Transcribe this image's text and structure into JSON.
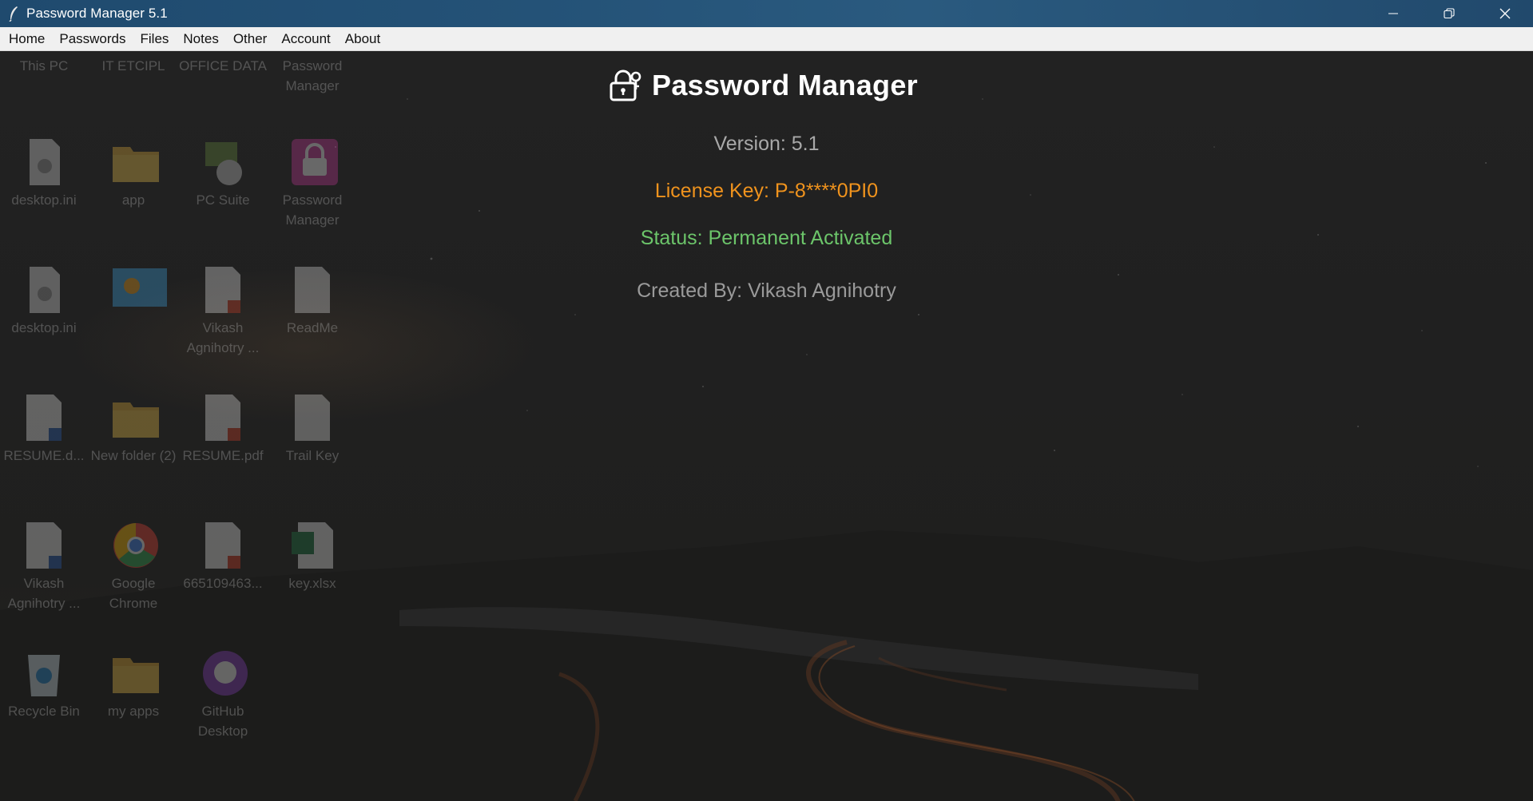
{
  "window": {
    "title": "Password Manager 5.1"
  },
  "menu": [
    {
      "label": "Home"
    },
    {
      "label": "Passwords"
    },
    {
      "label": "Files"
    },
    {
      "label": "Notes"
    },
    {
      "label": "Other"
    },
    {
      "label": "Account"
    },
    {
      "label": "About"
    }
  ],
  "about": {
    "app_name": "Password Manager",
    "version": "Version: 5.1",
    "license": "License Key: P-8****0PI0",
    "status": "Status: Permanent Activated",
    "created_by": "Created By: Vikash Agnihotry"
  },
  "desktop_icons": [
    {
      "label": "This PC",
      "icon": "pc-icon"
    },
    {
      "label": "IT ETCIPL",
      "icon": "folder-icon"
    },
    {
      "label": "OFFICE DATA",
      "icon": "folder-icon"
    },
    {
      "label": "Password Manager",
      "icon": "folder-icon"
    },
    {
      "label": "desktop.ini",
      "icon": "settings-file-icon"
    },
    {
      "label": "app",
      "icon": "folder-icon"
    },
    {
      "label": "PC Suite",
      "icon": "pc-suite-icon"
    },
    {
      "label": "Password Manager",
      "icon": "lock-app-icon"
    },
    {
      "label": "desktop.ini",
      "icon": "settings-file-icon"
    },
    {
      "label": "",
      "icon": "image-file-icon"
    },
    {
      "label": "Vikash Agnihotry ...",
      "icon": "pdf-file-icon"
    },
    {
      "label": "ReadMe",
      "icon": "text-file-icon"
    },
    {
      "label": "RESUME.d...",
      "icon": "word-file-icon"
    },
    {
      "label": "New folder (2)",
      "icon": "folder-icon"
    },
    {
      "label": "RESUME.pdf",
      "icon": "pdf-file-icon"
    },
    {
      "label": "Trail Key",
      "icon": "text-file-icon"
    },
    {
      "label": "Vikash Agnihotry ...",
      "icon": "word-file-icon"
    },
    {
      "label": "Google Chrome",
      "icon": "chrome-icon"
    },
    {
      "label": "665109463...",
      "icon": "pdf-file-icon"
    },
    {
      "label": "key.xlsx",
      "icon": "excel-file-icon"
    },
    {
      "label": "Recycle Bin",
      "icon": "recycle-bin-icon"
    },
    {
      "label": "my apps",
      "icon": "folder-icon"
    },
    {
      "label": "GitHub Desktop",
      "icon": "github-icon"
    }
  ],
  "colors": {
    "titlebar": "#245277",
    "license": "#f0931d",
    "status": "#6cc56a",
    "version": "#a9a9a9"
  }
}
